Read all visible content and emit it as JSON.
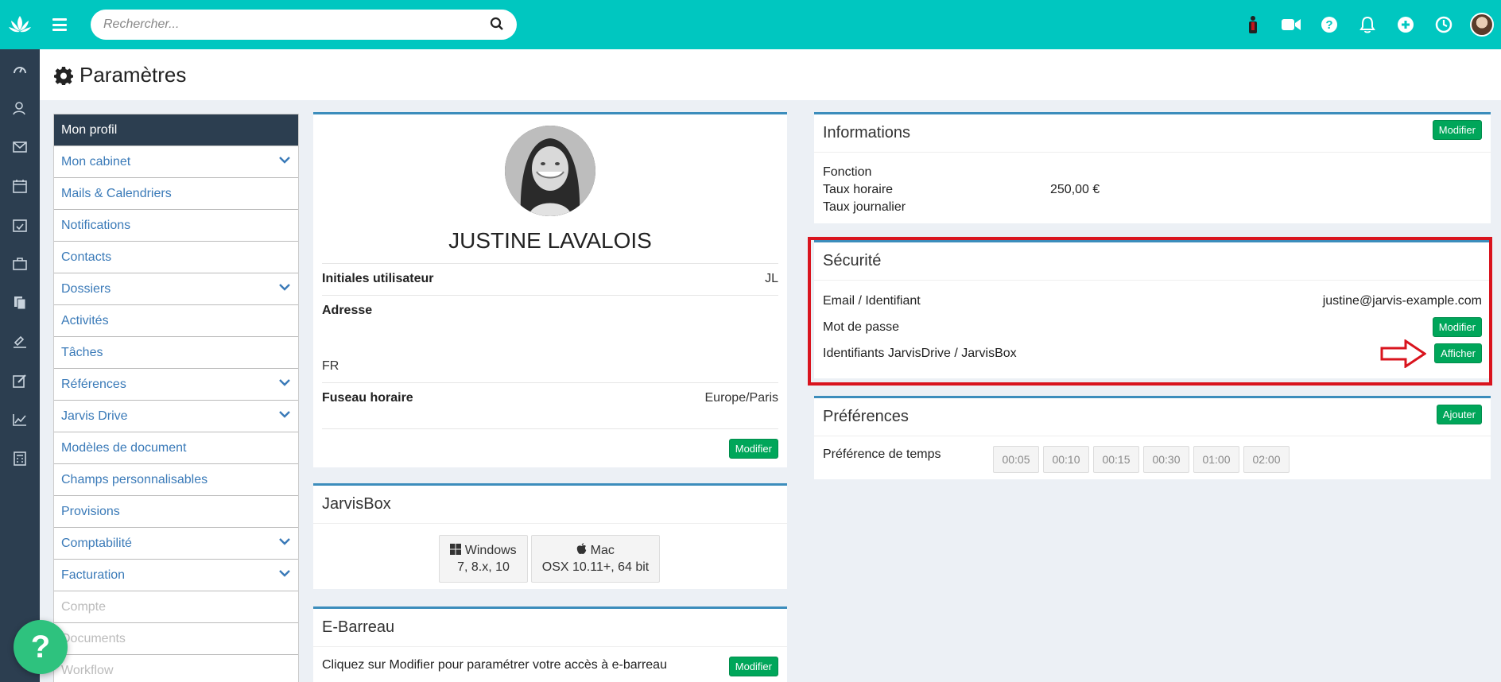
{
  "search": {
    "placeholder": "Rechercher..."
  },
  "page": {
    "title": "Paramètres"
  },
  "menu": {
    "header": "Mon profil",
    "items": [
      {
        "label": "Mon cabinet",
        "expandable": true,
        "disabled": false
      },
      {
        "label": "Mails & Calendriers",
        "expandable": false,
        "disabled": false
      },
      {
        "label": "Notifications",
        "expandable": false,
        "disabled": false
      },
      {
        "label": "Contacts",
        "expandable": false,
        "disabled": false
      },
      {
        "label": "Dossiers",
        "expandable": true,
        "disabled": false
      },
      {
        "label": "Activités",
        "expandable": false,
        "disabled": false
      },
      {
        "label": "Tâches",
        "expandable": false,
        "disabled": false
      },
      {
        "label": "Références",
        "expandable": true,
        "disabled": false
      },
      {
        "label": "Jarvis Drive",
        "expandable": true,
        "disabled": false
      },
      {
        "label": "Modèles de document",
        "expandable": false,
        "disabled": false
      },
      {
        "label": "Champs personnalisables",
        "expandable": false,
        "disabled": false
      },
      {
        "label": "Provisions",
        "expandable": false,
        "disabled": false
      },
      {
        "label": "Comptabilité",
        "expandable": true,
        "disabled": false
      },
      {
        "label": "Facturation",
        "expandable": true,
        "disabled": false
      },
      {
        "label": "Compte",
        "expandable": false,
        "disabled": true
      },
      {
        "label": "Documents",
        "expandable": false,
        "disabled": true
      },
      {
        "label": "Workflow",
        "expandable": false,
        "disabled": true
      }
    ]
  },
  "profile": {
    "name": "JUSTINE LAVALOIS",
    "initials_label": "Initiales utilisateur",
    "initials_value": "JL",
    "address_label": "Adresse",
    "address_country": "FR",
    "timezone_label": "Fuseau horaire",
    "timezone_value": "Europe/Paris",
    "edit_label": "Modifier"
  },
  "jarvisbox": {
    "title": "JarvisBox",
    "windows_name": "Windows",
    "windows_versions": "7, 8.x, 10",
    "mac_name": "Mac",
    "mac_versions": "OSX 10.11+, 64 bit"
  },
  "ebarreau": {
    "title": "E-Barreau",
    "text": "Cliquez sur Modifier pour paramétrer votre accès à e-barreau",
    "edit_label": "Modifier"
  },
  "informations": {
    "title": "Informations",
    "edit_label": "Modifier",
    "function_label": "Fonction",
    "hourly_label": "Taux horaire",
    "hourly_value": "250,00 €",
    "daily_label": "Taux journalier"
  },
  "security": {
    "title": "Sécurité",
    "email_label": "Email / Identifiant",
    "email_value": "justine@jarvis-example.com",
    "password_label": "Mot de passe",
    "password_button": "Modifier",
    "drive_label": "Identifiants JarvisDrive / JarvisBox",
    "drive_button": "Afficher"
  },
  "preferences": {
    "title": "Préférences",
    "add_label": "Ajouter",
    "time_label": "Préférence de temps",
    "time_options": [
      "00:05",
      "00:10",
      "00:15",
      "00:30",
      "01:00",
      "02:00"
    ]
  },
  "help": {
    "label": "?"
  },
  "colors": {
    "topbar": "#00c7c0",
    "sidebar": "#2c3e50",
    "accent_green": "#00a65a",
    "highlight_red": "#d9141e",
    "panel_border": "#3c8dbc"
  }
}
